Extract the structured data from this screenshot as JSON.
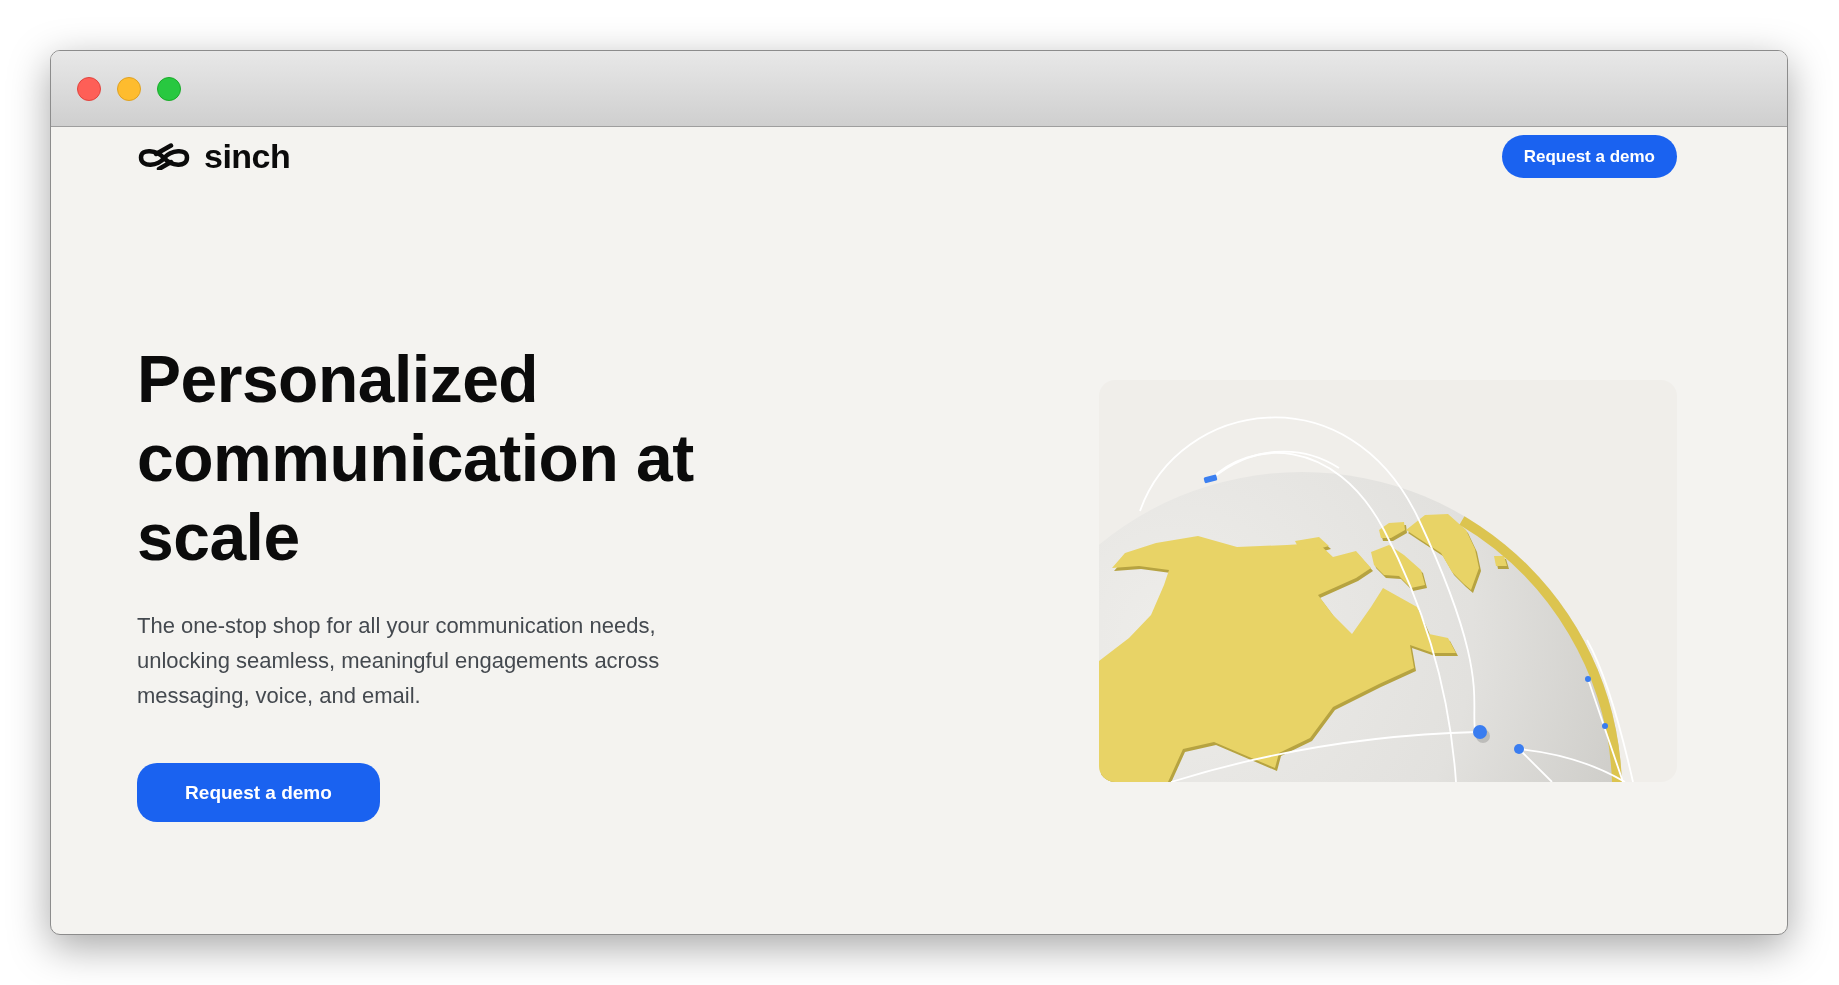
{
  "nav": {
    "logo": {
      "text": "sinch"
    },
    "cta": {
      "label": "Request a demo"
    }
  },
  "hero": {
    "title": "Personalized communication at scale",
    "description": "The one-stop shop for all your communication needs, unlocking seamless, meaningful engagements across messaging, voice, and email.",
    "cta": {
      "label": "Request a demo"
    },
    "illustration": {
      "kind": "globe"
    }
  }
}
